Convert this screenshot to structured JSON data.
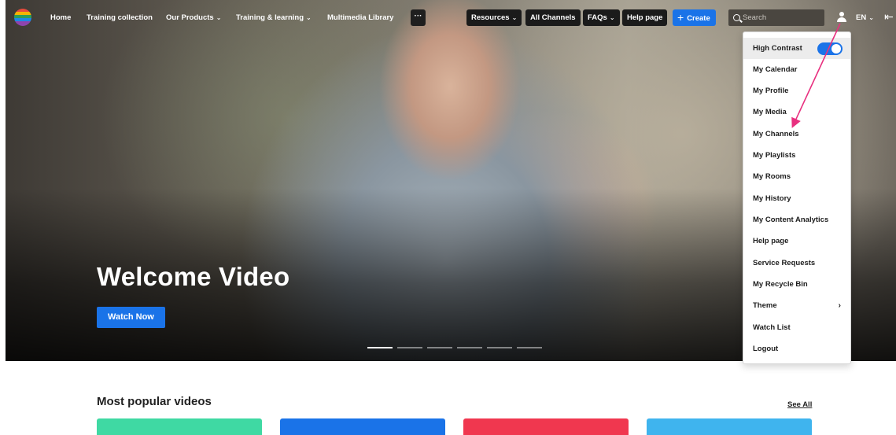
{
  "nav": {
    "items": [
      {
        "label": "Home",
        "dropdown": false
      },
      {
        "label": "Training collection",
        "dropdown": false
      },
      {
        "label": "Our Products",
        "dropdown": true
      },
      {
        "label": "Training & learning",
        "dropdown": true
      },
      {
        "label": "Multimedia Library",
        "dropdown": false
      }
    ],
    "more_label": "···",
    "resources_label": "Resources",
    "all_channels_label": "All Channels",
    "faqs_label": "FAQs",
    "help_label": "Help page",
    "create_label": "Create",
    "search_placeholder": "Search",
    "language": "EN"
  },
  "hero": {
    "title": "Welcome Video",
    "button_label": "Watch Now",
    "slides_total": 6,
    "active_slide": 1
  },
  "user_menu": {
    "items": [
      {
        "label": "High Contrast",
        "toggle": true,
        "toggle_on": true
      },
      {
        "label": "My Calendar"
      },
      {
        "label": "My Profile"
      },
      {
        "label": "My Media"
      },
      {
        "label": "My Channels"
      },
      {
        "label": "My Playlists"
      },
      {
        "label": "My Rooms"
      },
      {
        "label": "My History"
      },
      {
        "label": "My Content Analytics"
      },
      {
        "label": "Help page"
      },
      {
        "label": "Service Requests"
      },
      {
        "label": "My Recycle Bin"
      },
      {
        "label": "Theme",
        "submenu": true
      },
      {
        "label": "Watch List"
      },
      {
        "label": "Logout"
      }
    ]
  },
  "popular": {
    "title": "Most popular videos",
    "see_all": "See All",
    "card_colors": [
      "#3fd9a3",
      "#1a73e8",
      "#f0374f",
      "#3fb4ee"
    ]
  },
  "colors": {
    "accent": "#1a73e8",
    "annotation_arrow": "#e8307f"
  }
}
